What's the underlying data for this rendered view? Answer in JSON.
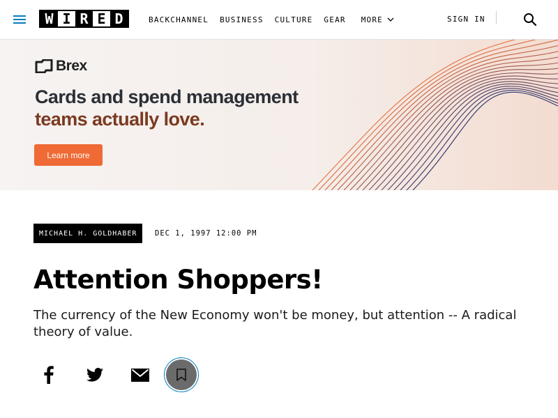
{
  "header": {
    "logo": {
      "letters": [
        "W",
        "I",
        "R",
        "E",
        "D"
      ],
      "label": "WIRED"
    },
    "nav": [
      {
        "label": "BACKCHANNEL"
      },
      {
        "label": "BUSINESS"
      },
      {
        "label": "CULTURE"
      },
      {
        "label": "GEAR"
      }
    ],
    "more_label": "MORE",
    "sign_in_label": "SIGN IN",
    "icons": {
      "menu": "hamburger-menu-icon",
      "search": "search-icon",
      "more": "chevron-down-icon"
    },
    "accent_color": "#057dbc"
  },
  "ad": {
    "brand": "Brex",
    "headline_line1": "Cards and spend management",
    "headline_line2": "teams actually love.",
    "cta_label": "Learn more",
    "colors": {
      "cta": "#ef6a35",
      "headline_dark": "#2b2f36",
      "headline_warm": "#7a3a20"
    }
  },
  "article": {
    "author": "MICHAEL H. GOLDHABER",
    "date": "DEC 1, 1997 12:00 PM",
    "title": "Attention Shoppers!",
    "dek": "The currency of the New Economy won't be money, but attention -- A radical theory of value."
  },
  "share": {
    "buttons": [
      {
        "name": "facebook",
        "icon": "facebook-icon"
      },
      {
        "name": "twitter",
        "icon": "twitter-icon"
      },
      {
        "name": "email",
        "icon": "email-icon"
      },
      {
        "name": "save",
        "icon": "bookmark-icon"
      }
    ]
  }
}
